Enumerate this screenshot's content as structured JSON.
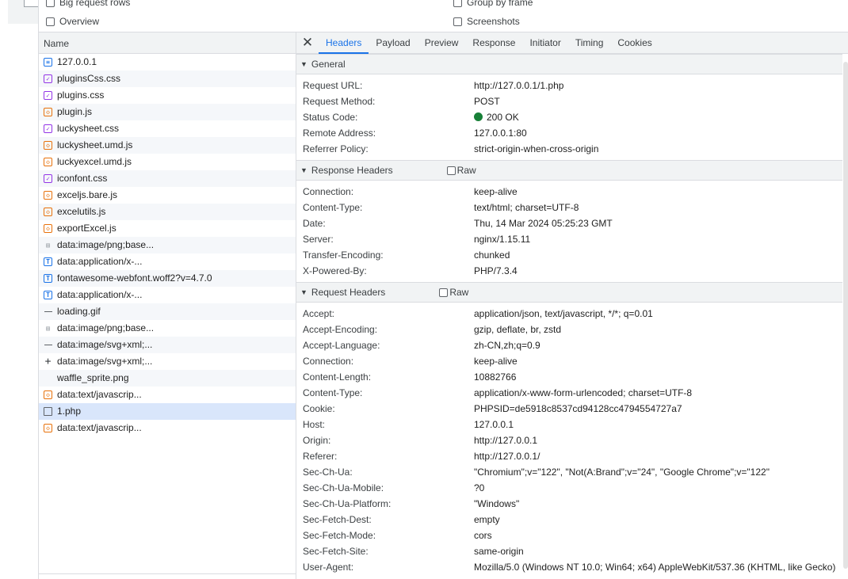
{
  "options": {
    "big_request_rows": "Big request rows",
    "group_by_frame": "Group by frame",
    "overview": "Overview",
    "screenshots": "Screenshots"
  },
  "list": {
    "header": "Name",
    "items": [
      {
        "name": "127.0.0.1",
        "icon": "document-icon"
      },
      {
        "name": "pluginsCss.css",
        "icon": "stylesheet-icon"
      },
      {
        "name": "plugins.css",
        "icon": "stylesheet-icon"
      },
      {
        "name": "plugin.js",
        "icon": "script-icon"
      },
      {
        "name": "luckysheet.css",
        "icon": "stylesheet-icon"
      },
      {
        "name": "luckysheet.umd.js",
        "icon": "script-icon"
      },
      {
        "name": "luckyexcel.umd.js",
        "icon": "script-icon"
      },
      {
        "name": "iconfont.css",
        "icon": "stylesheet-icon"
      },
      {
        "name": "exceljs.bare.js",
        "icon": "script-icon"
      },
      {
        "name": "excelutils.js",
        "icon": "script-icon"
      },
      {
        "name": "exportExcel.js",
        "icon": "script-icon"
      },
      {
        "name": "data:image/png;base...",
        "icon": "image-icon"
      },
      {
        "name": "data:application/x-...",
        "icon": "font-icon"
      },
      {
        "name": "fontawesome-webfont.woff2?v=4.7.0",
        "icon": "font-icon"
      },
      {
        "name": "data:application/x-...",
        "icon": "font-icon"
      },
      {
        "name": "loading.gif",
        "icon": "dash-icon"
      },
      {
        "name": "data:image/png;base...",
        "icon": "image-icon"
      },
      {
        "name": "data:image/svg+xml;...",
        "icon": "dash-icon"
      },
      {
        "name": "data:image/svg+xml;...",
        "icon": "plus-icon"
      },
      {
        "name": "waffle_sprite.png",
        "icon": "blank-icon"
      },
      {
        "name": "data:text/javascrip...",
        "icon": "script-icon"
      },
      {
        "name": "1.php",
        "icon": "file-icon",
        "selected": true
      },
      {
        "name": "data:text/javascrip...",
        "icon": "script-icon"
      }
    ]
  },
  "tabs": [
    "Headers",
    "Payload",
    "Preview",
    "Response",
    "Initiator",
    "Timing",
    "Cookies"
  ],
  "active_tab": "Headers",
  "raw_label": "Raw",
  "general": {
    "title": "General",
    "rows": [
      {
        "k": "Request URL:",
        "v": "http://127.0.0.1/1.php"
      },
      {
        "k": "Request Method:",
        "v": "POST"
      },
      {
        "k": "Status Code:",
        "v": "200 OK",
        "status": true
      },
      {
        "k": "Remote Address:",
        "v": "127.0.0.1:80"
      },
      {
        "k": "Referrer Policy:",
        "v": "strict-origin-when-cross-origin"
      }
    ]
  },
  "response_headers": {
    "title": "Response Headers",
    "rows": [
      {
        "k": "Connection:",
        "v": "keep-alive"
      },
      {
        "k": "Content-Type:",
        "v": "text/html; charset=UTF-8"
      },
      {
        "k": "Date:",
        "v": "Thu, 14 Mar 2024 05:25:23 GMT"
      },
      {
        "k": "Server:",
        "v": "nginx/1.15.11"
      },
      {
        "k": "Transfer-Encoding:",
        "v": "chunked"
      },
      {
        "k": "X-Powered-By:",
        "v": "PHP/7.3.4"
      }
    ]
  },
  "request_headers": {
    "title": "Request Headers",
    "rows": [
      {
        "k": "Accept:",
        "v": "application/json, text/javascript, */*; q=0.01"
      },
      {
        "k": "Accept-Encoding:",
        "v": "gzip, deflate, br, zstd"
      },
      {
        "k": "Accept-Language:",
        "v": "zh-CN,zh;q=0.9"
      },
      {
        "k": "Connection:",
        "v": "keep-alive"
      },
      {
        "k": "Content-Length:",
        "v": "10882766"
      },
      {
        "k": "Content-Type:",
        "v": "application/x-www-form-urlencoded; charset=UTF-8"
      },
      {
        "k": "Cookie:",
        "v": "PHPSID=de5918c8537cd94128cc4794554727a7"
      },
      {
        "k": "Host:",
        "v": "127.0.0.1"
      },
      {
        "k": "Origin:",
        "v": "http://127.0.0.1"
      },
      {
        "k": "Referer:",
        "v": "http://127.0.0.1/"
      },
      {
        "k": "Sec-Ch-Ua:",
        "v": "\"Chromium\";v=\"122\", \"Not(A:Brand\";v=\"24\", \"Google Chrome\";v=\"122\""
      },
      {
        "k": "Sec-Ch-Ua-Mobile:",
        "v": "?0"
      },
      {
        "k": "Sec-Ch-Ua-Platform:",
        "v": "\"Windows\""
      },
      {
        "k": "Sec-Fetch-Dest:",
        "v": "empty"
      },
      {
        "k": "Sec-Fetch-Mode:",
        "v": "cors"
      },
      {
        "k": "Sec-Fetch-Site:",
        "v": "same-origin"
      },
      {
        "k": "User-Agent:",
        "v": "Mozilla/5.0 (Windows NT 10.0; Win64; x64) AppleWebKit/537.36 (KHTML, like Gecko)"
      }
    ]
  },
  "colors": {
    "accent": "#1a73e8",
    "status_ok": "#188038",
    "selected_row": "#d9e6fb"
  }
}
